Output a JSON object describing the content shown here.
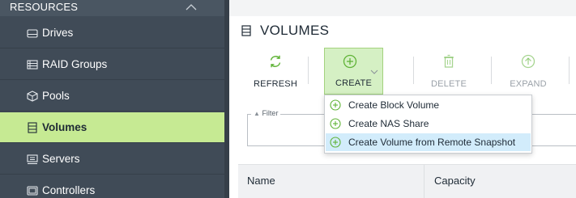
{
  "sidebar": {
    "section_title": "RESOURCES",
    "items": [
      {
        "label": "Drives",
        "icon": "drive-icon"
      },
      {
        "label": "RAID Groups",
        "icon": "raid-icon"
      },
      {
        "label": "Pools",
        "icon": "pool-icon"
      },
      {
        "label": "Volumes",
        "icon": "volume-icon",
        "active": true
      },
      {
        "label": "Servers",
        "icon": "server-icon"
      },
      {
        "label": "Controllers",
        "icon": "controller-icon"
      }
    ]
  },
  "main": {
    "title": "VOLUMES",
    "toolbar": {
      "refresh": "REFRESH",
      "create": "CREATE",
      "delete": "DELETE",
      "expand": "EXPAND"
    },
    "filter_label": "Filter",
    "table": {
      "columns": [
        "Name",
        "Capacity"
      ]
    },
    "create_menu": [
      "Create Block Volume",
      "Create NAS Share",
      "Create Volume from Remote Snapshot"
    ]
  },
  "colors": {
    "sidebar_bg": "#404b57",
    "active_item": "#c6ea93",
    "accent_green": "#5fb336",
    "hover_blue": "#d2ecfb"
  }
}
